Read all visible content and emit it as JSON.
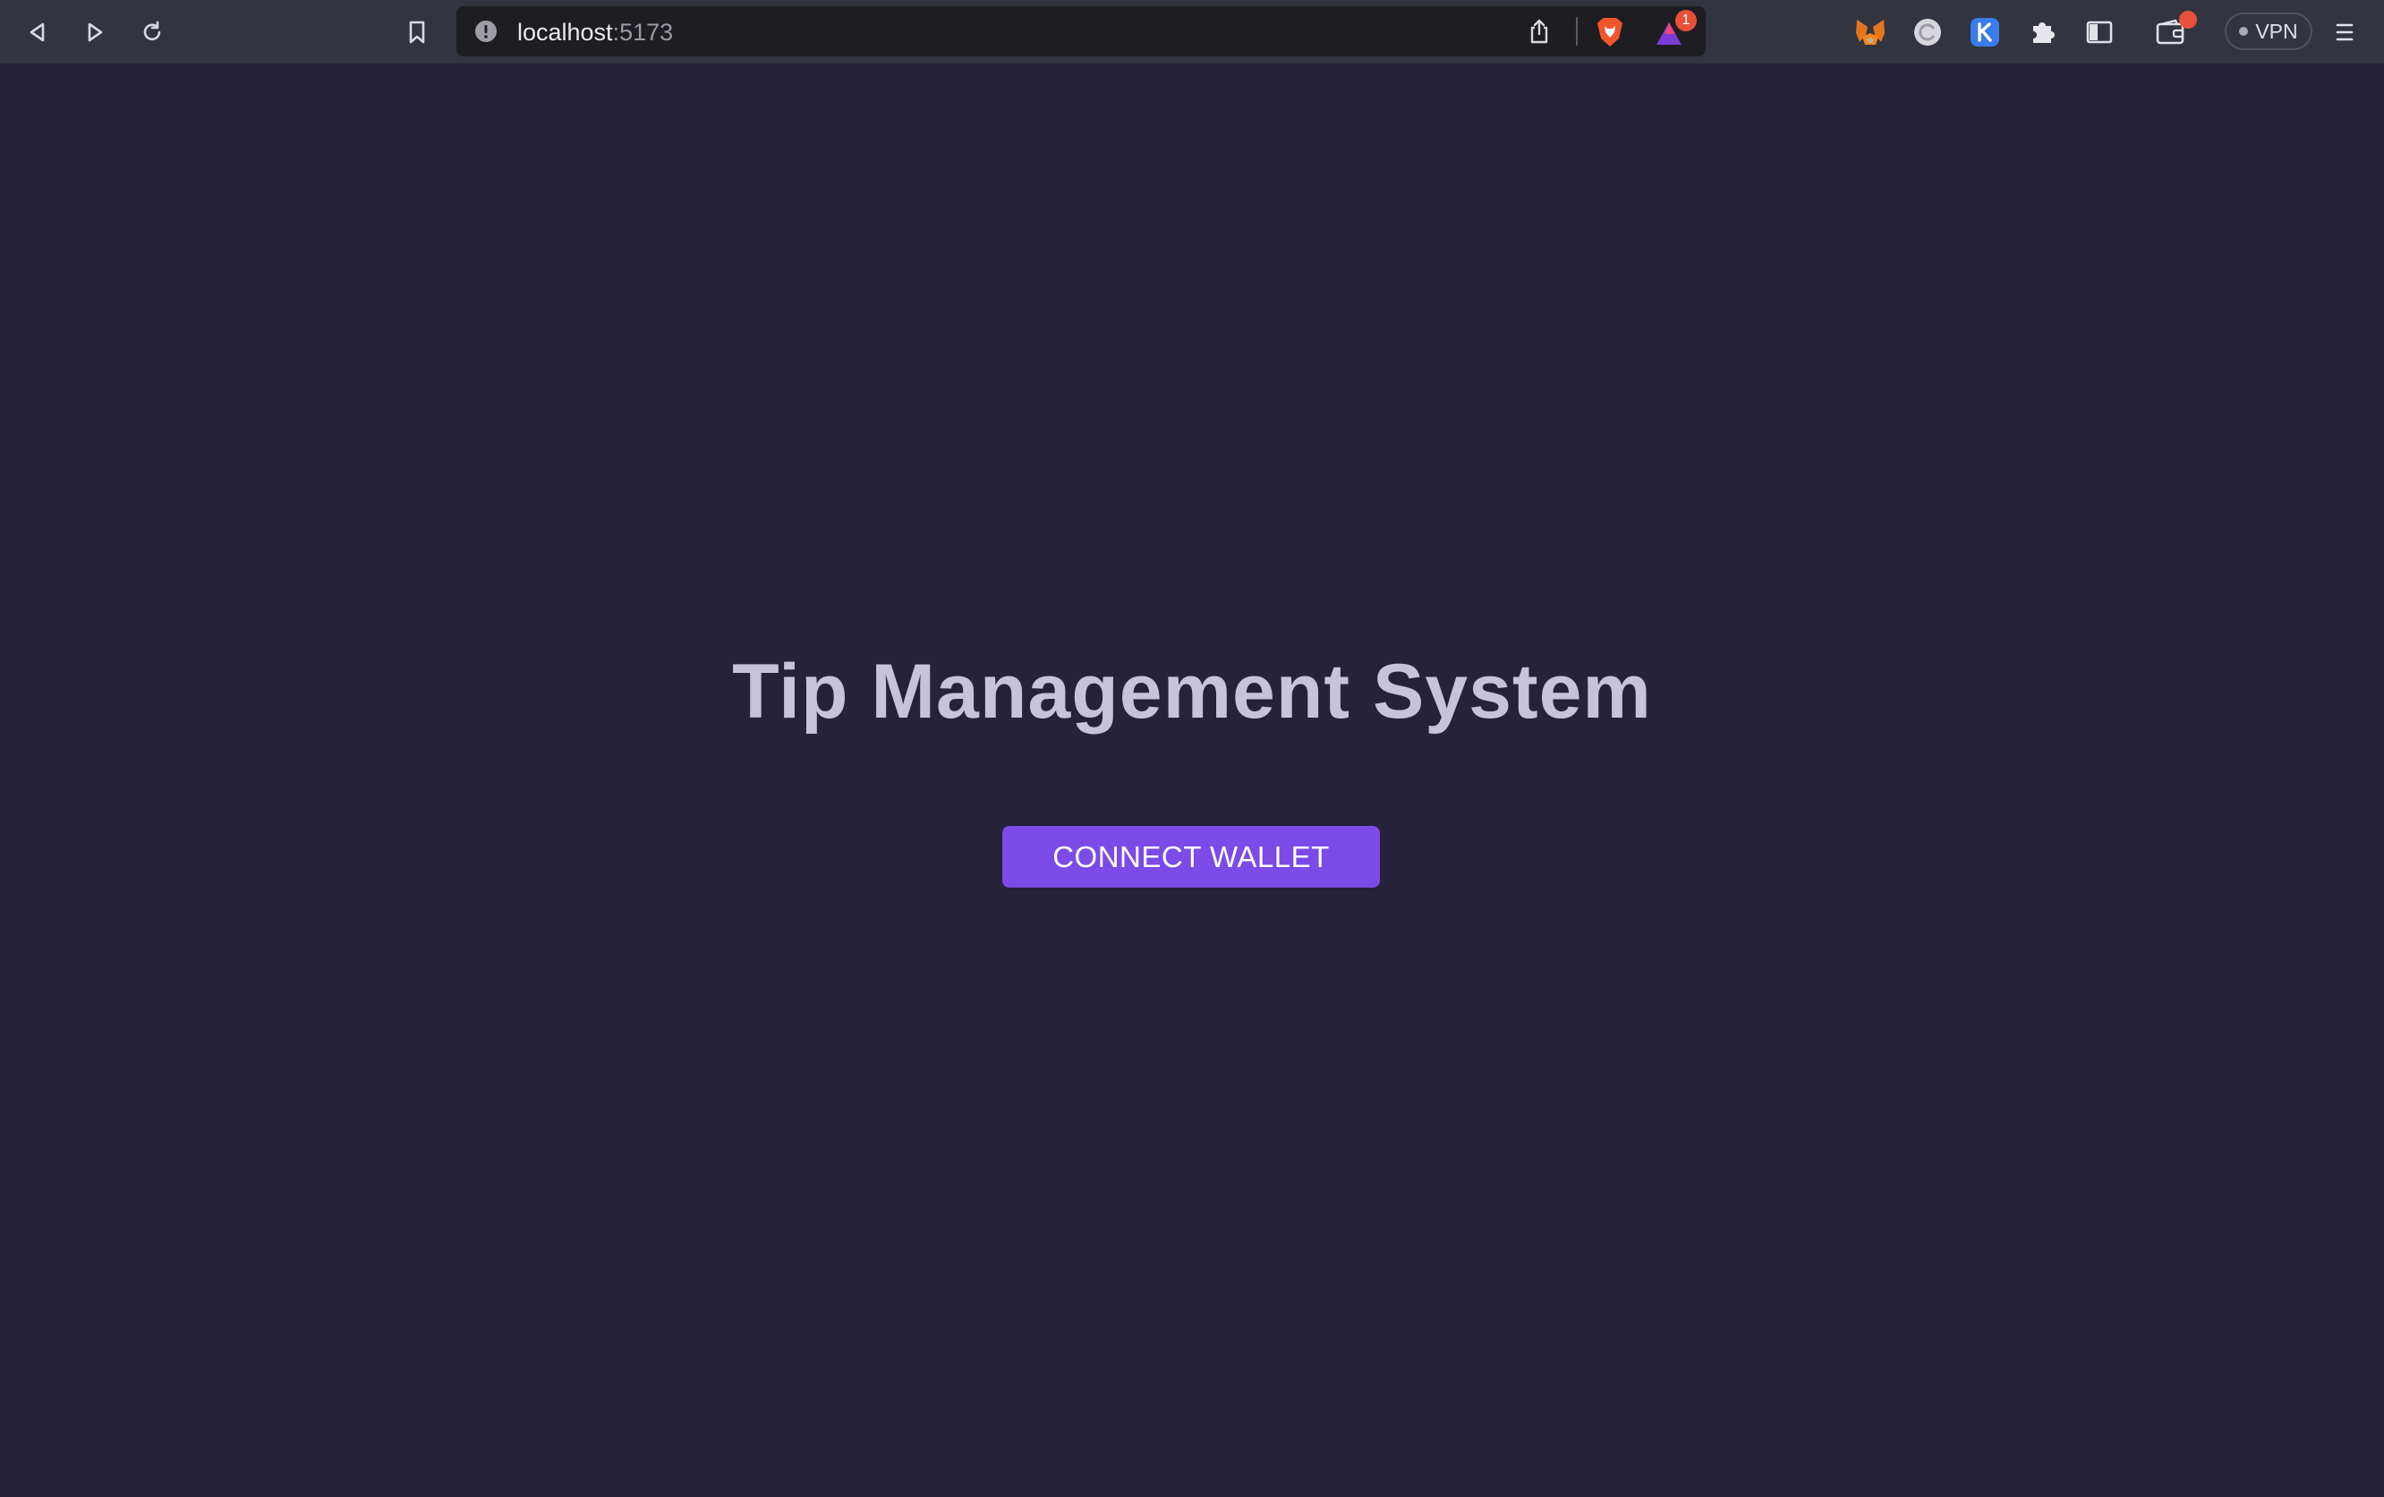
{
  "browser": {
    "url_host": "localhost",
    "url_port": ":5173",
    "notification_count": "1",
    "vpn_label": "VPN"
  },
  "page": {
    "title": "Tip Management System",
    "connect_button": "CONNECT WALLET"
  },
  "colors": {
    "background": "#26223a",
    "title": "#c8c3dc",
    "button": "#7c4ae6",
    "toolbar": "#323440"
  }
}
